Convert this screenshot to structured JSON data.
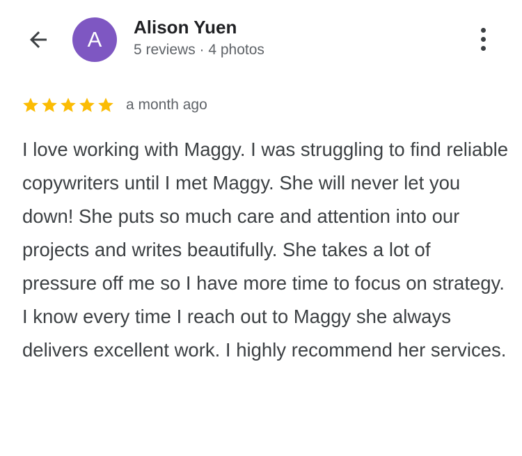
{
  "header": {
    "back_icon": "arrow-back-icon",
    "more_icon": "more-vert-icon"
  },
  "reviewer": {
    "avatar_letter": "A",
    "avatar_color": "#7e57c2",
    "name": "Alison Yuen",
    "meta": "5 reviews · 4 photos"
  },
  "review": {
    "rating": 5,
    "rating_max": 5,
    "star_color": "#fbbc04",
    "date": "a month ago",
    "text": "I love working with Maggy. I was struggling to find reliable copywriters until I met Maggy. She will never let you down! She puts so much care and attention into our projects and writes beautifully. She takes a lot of pressure off me so I have more time to focus on strategy. I know every time I reach out to Maggy she always delivers excellent work. I highly recommend her services."
  }
}
